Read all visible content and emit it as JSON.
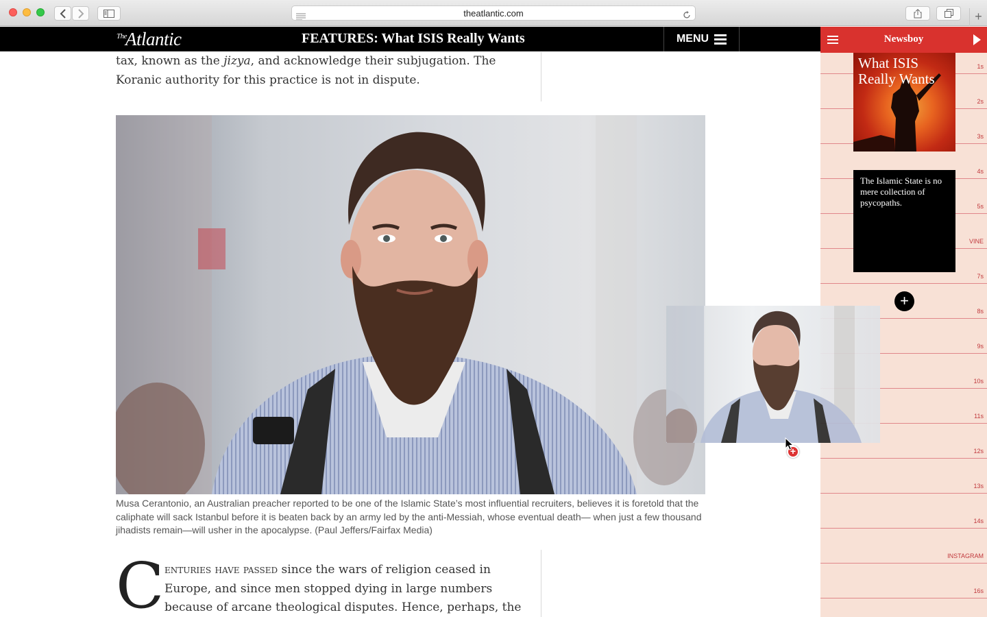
{
  "browser": {
    "url": "theatlantic.com",
    "new_tab_symbol": "+"
  },
  "site": {
    "logo_small": "The",
    "logo_main": "Atlantic",
    "header_title": "FEATURES: What ISIS Really Wants",
    "menu_label": "MENU"
  },
  "article": {
    "para_top_1": "tax, known as the ",
    "para_top_em": "jizya",
    "para_top_2": ", and acknowledge their subjugation. The Koranic authority for this practice is not in dispute.",
    "caption": "Musa Cerantonio, an Australian preacher reported to be one of the Islamic State’s most influential recruiters, believes it is foretold that the caliphate will sack Istanbul before it is beaten back by an army led by the anti-Messiah, whose eventual death— when just a few thousand jihadists remain—will usher in the apocalypse. (Paul Jeffers/Fairfax Media)",
    "dropcap": "C",
    "para_bottom_smallcaps": "enturies have passed",
    "para_bottom_rest": " since the wars of religion ceased in Europe, and since men stopped dying in large numbers because of arcane theological disputes. Hence, perhaps, the incredulity and denial"
  },
  "drag": {
    "drop_symbol": "+"
  },
  "sidebar": {
    "title": "Newsboy",
    "card1_text": "What ISIS Really Wants",
    "card2_text": "The Islamic State is no mere collection of psycopaths.",
    "add_symbol": "+",
    "ticks": [
      "1s",
      "2s",
      "3s",
      "4s",
      "5s",
      "VINE",
      "7s",
      "8s",
      "9s",
      "10s",
      "11s",
      "12s",
      "13s",
      "14s",
      "INSTAGRAM",
      "16s"
    ]
  },
  "colors": {
    "sidebar_accent": "#d9322e",
    "sidebar_bg": "#f8e1d6",
    "header_bg": "#000000"
  }
}
